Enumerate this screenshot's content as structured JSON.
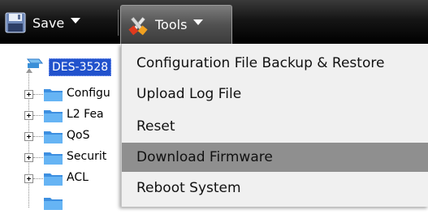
{
  "toolbar": {
    "save_label": "Save",
    "tools_label": "Tools"
  },
  "tree": {
    "root_label": "DES-3528",
    "items": [
      {
        "label": "Configu"
      },
      {
        "label": "L2 Fea"
      },
      {
        "label": "QoS"
      },
      {
        "label": "Securit"
      },
      {
        "label": "ACL"
      }
    ]
  },
  "menu": {
    "items": [
      {
        "label": "Configuration File Backup & Restore"
      },
      {
        "label": "Upload Log File"
      },
      {
        "label": "Reset"
      },
      {
        "label": "Download Firmware",
        "highlighted": true
      },
      {
        "label": "Reboot System"
      }
    ]
  },
  "colors": {
    "toolbar_bg": "#000000",
    "selection_blue": "#2152cc",
    "menu_bg": "#f0f0f0",
    "menu_highlight": "#8f8f8f",
    "folder_blue": "#4a9be6"
  },
  "icons": [
    "floppy-disk-icon",
    "tools-icon",
    "switch-device-icon",
    "folder-icon",
    "expand-plus-icon",
    "dropdown-caret-icon"
  ]
}
